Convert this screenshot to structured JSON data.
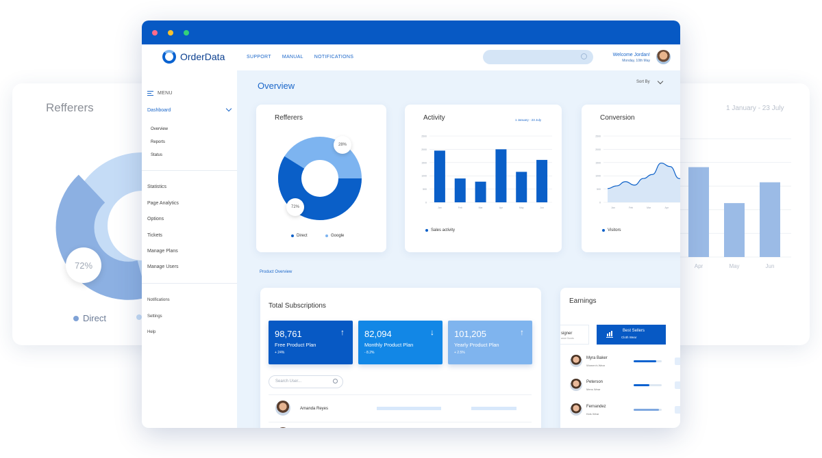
{
  "bg_left": {
    "title": "Refferers",
    "pct": "72%",
    "legend_direct": "Direct"
  },
  "bg_right": {
    "date": "1 January - 23 July",
    "months": [
      "Apr",
      "May",
      "Jun"
    ],
    "values": [
      1900,
      1140,
      1580
    ]
  },
  "app": {
    "name": "OrderData"
  },
  "nav": {
    "support": "SUPPORT",
    "manual": "MANUAL",
    "notifications": "NOTIFICATIONS"
  },
  "user": {
    "welcome": "Welcome Jordan!",
    "date": "Monday, 10th May"
  },
  "sidebar": {
    "menu": "MENU",
    "dashboard": "Dashboard",
    "sub": [
      "Overview",
      "Reports",
      "Status"
    ],
    "items": [
      "Statistics",
      "Page Analytics",
      "Options",
      "Tickets",
      "Manage Plans",
      "Manage Users"
    ],
    "bottom": [
      "Notifications",
      "Settings",
      "Help"
    ]
  },
  "main": {
    "title": "Overview",
    "sort_by": "Sort By",
    "product_overview": "Product Overview"
  },
  "refferers": {
    "title": "Refferers",
    "pct_google": "28%",
    "pct_direct": "72%",
    "legend": [
      "Direct",
      "Google"
    ]
  },
  "activity": {
    "title": "Activity",
    "date": "1 January - 23 July",
    "legend": "Sales activity"
  },
  "conversion": {
    "title": "Conversion",
    "legend": "Visitors"
  },
  "subscriptions": {
    "title": "Total Subscriptions",
    "stats": [
      {
        "value": "98,761",
        "name": "Free Product Plan",
        "change": "+ 24%",
        "arrow": "↑",
        "color": "#0759c4"
      },
      {
        "value": "82,094",
        "name": "Monthly Product Plan",
        "change": "- 8.2%",
        "arrow": "↓",
        "color": "#1287e6"
      },
      {
        "value": "101,205",
        "name": "Yearly Product Plan",
        "change": "+ 2.5%",
        "arrow": "↑",
        "color": "#7fb4ee"
      }
    ],
    "search_placeholder": "Search User...",
    "users": [
      {
        "name": "Amanda Reyes"
      }
    ]
  },
  "earnings": {
    "title": "Earnings",
    "tab_left_title": "signer",
    "tab_left_sub": "ance Goods",
    "best_sellers": "Best Sellers",
    "best_sellers_sub": "Cloth Wear",
    "people": [
      {
        "name": "Myra Baker",
        "role": "Women's Wear",
        "level": 0.8
      },
      {
        "name": "Peterson",
        "role": "Mens Wear",
        "level": 0.55
      },
      {
        "name": "Fernandez",
        "role": "Kids Wear",
        "level": 0.9
      }
    ]
  },
  "chart_data": [
    {
      "type": "pie",
      "title": "Refferers",
      "categories": [
        "Direct",
        "Google"
      ],
      "values": [
        72,
        28
      ],
      "colors": [
        "#0a5fc8",
        "#7db4f0"
      ]
    },
    {
      "type": "bar",
      "title": "Activity",
      "categories": [
        "Jan",
        "Feb",
        "Mar",
        "Apr",
        "May",
        "Jun"
      ],
      "values": [
        1950,
        900,
        780,
        2000,
        1150,
        1600
      ],
      "ylim": [
        0,
        2500
      ],
      "yticks": [
        "0",
        "500",
        "1000",
        "1500",
        "2000",
        "2500"
      ],
      "series": [
        {
          "name": "Sales activity",
          "values": [
            1950,
            900,
            780,
            2000,
            1150,
            1600
          ]
        }
      ],
      "grid": true,
      "legend": "bottom-left"
    },
    {
      "type": "area",
      "title": "Conversion",
      "categories": [
        "Jan",
        "Feb",
        "Mar",
        "Apr",
        "May",
        "Jun"
      ],
      "x": [
        0,
        0.5,
        1,
        1.5,
        2,
        2.5,
        3,
        3.5,
        4,
        4.5,
        5,
        5.5
      ],
      "values": [
        520,
        620,
        780,
        650,
        900,
        1050,
        1480,
        1350,
        900,
        620,
        200,
        0
      ],
      "ylim": [
        0,
        2500
      ],
      "yticks": [
        "0",
        "500",
        "1000",
        "1500",
        "2000",
        "2500"
      ],
      "series": [
        {
          "name": "Visitors"
        }
      ],
      "grid": true,
      "legend": "bottom-left"
    }
  ]
}
